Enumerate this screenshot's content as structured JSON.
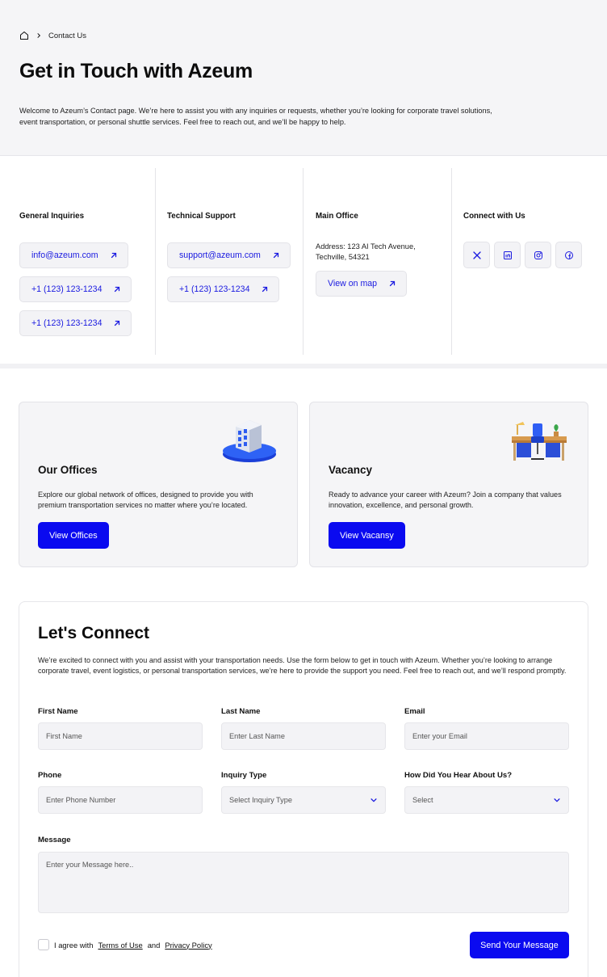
{
  "breadcrumb": {
    "home_icon": "home-icon",
    "separator_icon": "chevron-right-icon",
    "current": "Contact Us"
  },
  "hero": {
    "title": "Get in Touch with Azeum",
    "description": "Welcome to Azeum’s Contact page. We’re here to assist you with any inquiries or requests, whether you’re looking for corporate travel solutions, event transportation, or personal shuttle services. Feel free to reach out, and we’ll be happy to help."
  },
  "contacts": {
    "general": {
      "title": "General Inquiries",
      "items": [
        "info@azeum.com",
        "+1 (123) 123-1234",
        "+1 (123) 123-1234"
      ]
    },
    "technical": {
      "title": "Technical Support",
      "items": [
        "support@azeum.com",
        "+1 (123) 123-1234"
      ]
    },
    "office": {
      "title": "Main Office",
      "address": "Address: 123 AI Tech Avenue, Techville, 54321",
      "map_label": "View on map"
    },
    "social": {
      "title": "Connect with Us",
      "icons": [
        "x-twitter-icon",
        "linkedin-icon",
        "instagram-icon",
        "facebook-icon"
      ]
    }
  },
  "cards": {
    "offices": {
      "title": "Our Offices",
      "description": "Explore our global network of offices, designed to provide you with premium transportation services no matter where you’re located.",
      "button": "View Offices",
      "illustration": "office-building-icon"
    },
    "vacancy": {
      "title": "Vacancy",
      "description": "Ready to advance your career with Azeum? Join a company that values innovation, excellence, and personal growth.",
      "button": "View Vacansy",
      "illustration": "desk-workspace-icon"
    }
  },
  "form": {
    "title": "Let's Connect",
    "intro": "We’re excited to connect with you and assist with your transportation needs. Use the form below to get in touch with Azeum. Whether you’re looking to arrange corporate travel, event logistics, or personal transportation services, we’re here to provide the support you need. Feel free to reach out, and we’ll respond promptly.",
    "first_name": {
      "label": "First Name",
      "placeholder": "First Name"
    },
    "last_name": {
      "label": "Last Name",
      "placeholder": "Enter Last Name"
    },
    "email": {
      "label": "Email",
      "placeholder": "Enter your Email"
    },
    "phone": {
      "label": "Phone",
      "placeholder": "Enter Phone Number"
    },
    "inquiry_type": {
      "label": "Inquiry Type",
      "value": "Select Inquiry Type"
    },
    "heard_about": {
      "label": "How Did You Hear About Us?",
      "value": "Select"
    },
    "message": {
      "label": "Message",
      "placeholder": "Enter your Message here.."
    },
    "agree": {
      "prefix": "I agree with",
      "terms": "Terms of Use",
      "and": "and",
      "privacy": "Privacy Policy",
      "checked": false
    },
    "submit": "Send Your Message"
  },
  "colors": {
    "accent": "#0a0af0",
    "link": "#1a1ae0",
    "surface": "#f5f5f7",
    "border": "#e3e3e8"
  }
}
